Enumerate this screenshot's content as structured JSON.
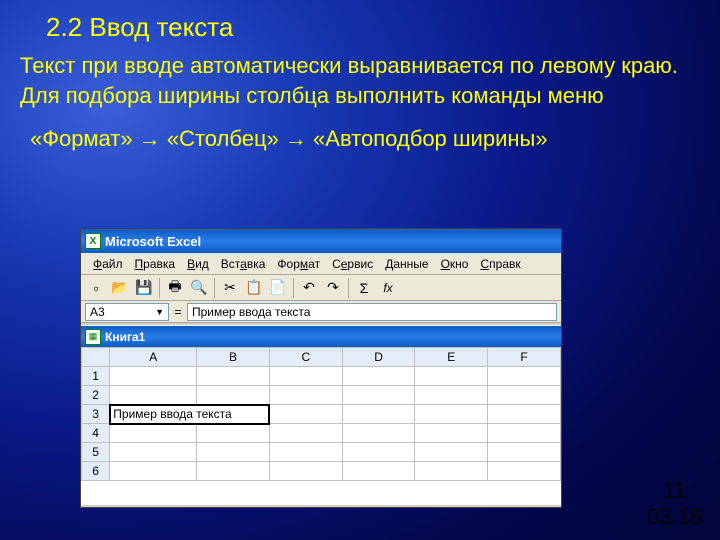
{
  "slide": {
    "title": "2.2 Ввод текста",
    "body": "Текст при вводе автоматически выравнивается по левому краю. Для подбора ширины столбца выполнить команды меню",
    "path": " «Формат» → «Столбец» → «Автоподбор ширины»",
    "page_num": "11",
    "date": "03.16"
  },
  "excel": {
    "app_title": "Microsoft Excel",
    "menu": [
      "Файл",
      "Правка",
      "Вид",
      "Вставка",
      "Формат",
      "Сервис",
      "Данные",
      "Окно",
      "Справк"
    ],
    "toolbar_fx": "fx",
    "name_box": "A3",
    "formula": "Пример ввода текста",
    "workbook": "Книга1",
    "cols": [
      "A",
      "B",
      "C",
      "D",
      "E",
      "F"
    ],
    "rows": [
      "1",
      "2",
      "3",
      "4",
      "5",
      "6"
    ],
    "cell_a3": "Пример ввода текста"
  }
}
